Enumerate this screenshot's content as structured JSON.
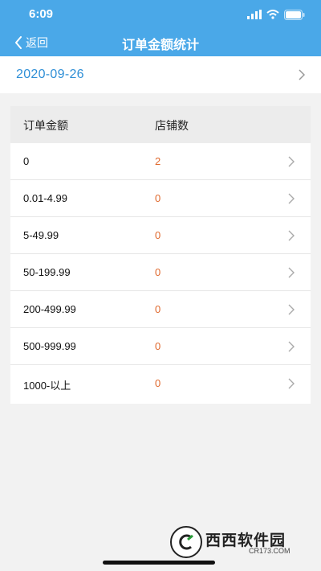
{
  "status": {
    "time": "6:09"
  },
  "nav": {
    "back_label": "返回",
    "title": "订单金额统计"
  },
  "date": "2020-09-26",
  "table": {
    "headers": [
      "订单金额",
      "店铺数"
    ],
    "rows": [
      {
        "range": "0",
        "count": "2"
      },
      {
        "range": "0.01-4.99",
        "count": "0"
      },
      {
        "range": "5-49.99",
        "count": "0"
      },
      {
        "range": "50-199.99",
        "count": "0"
      },
      {
        "range": "200-499.99",
        "count": "0"
      },
      {
        "range": "500-999.99",
        "count": "0"
      },
      {
        "range": "1000-以上",
        "count": "0"
      }
    ]
  },
  "watermark": {
    "text": "西西软件园",
    "sub": "CR173.COM"
  },
  "colors": {
    "header": "#4aa8e8",
    "date": "#2f8fd6",
    "count": "#e06a2f"
  },
  "icons": [
    "back-chevron-icon",
    "chevron-right-icon",
    "wifi-icon",
    "signal-icon",
    "battery-icon"
  ]
}
